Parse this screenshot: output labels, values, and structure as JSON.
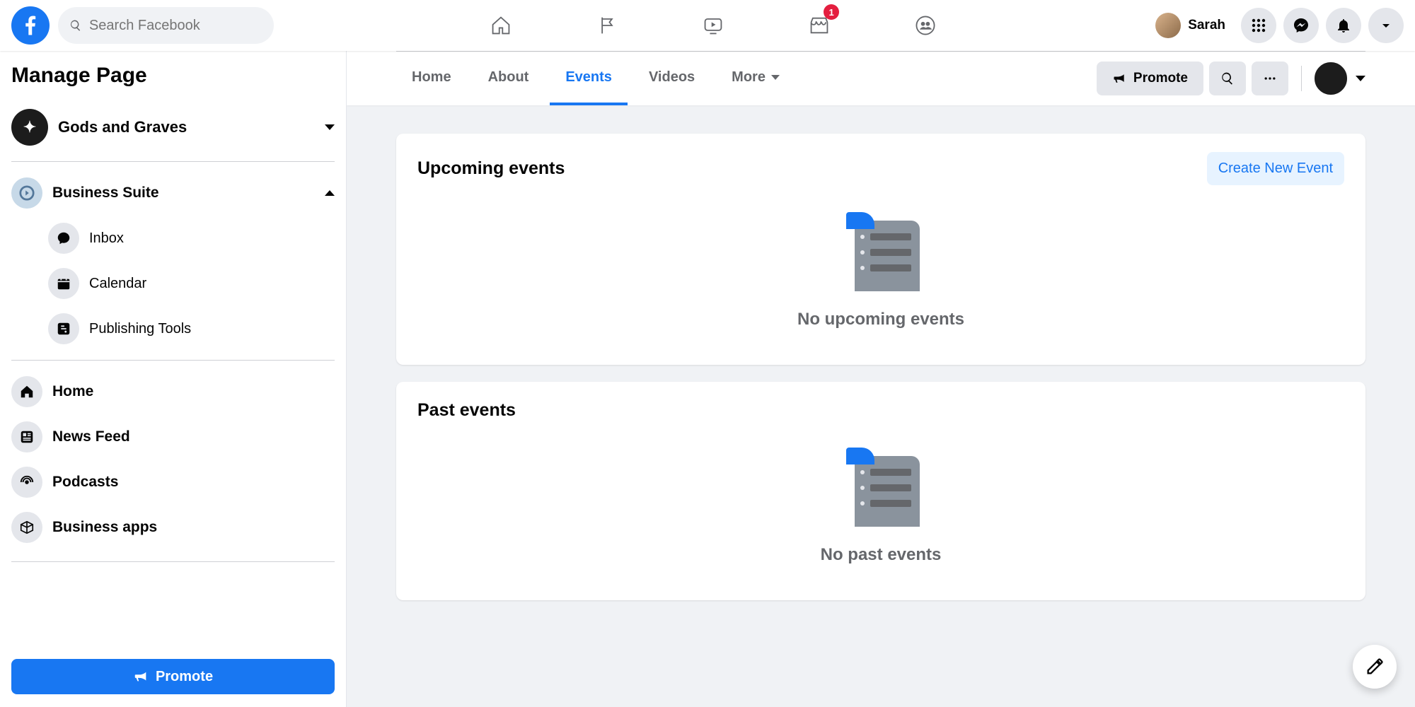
{
  "header": {
    "search_placeholder": "Search Facebook",
    "user_name": "Sarah",
    "marketplace_badge": "1"
  },
  "sidebar": {
    "title": "Manage Page",
    "page_name": "Gods and Graves",
    "business_suite_label": "Business Suite",
    "suite_items": [
      {
        "label": "Inbox"
      },
      {
        "label": "Calendar"
      },
      {
        "label": "Publishing Tools"
      }
    ],
    "nav_items": [
      {
        "label": "Home"
      },
      {
        "label": "News Feed"
      },
      {
        "label": "Podcasts"
      },
      {
        "label": "Business apps"
      }
    ],
    "promote_label": "Promote"
  },
  "page_tabs": {
    "items": [
      "Home",
      "About",
      "Events",
      "Videos",
      "More"
    ],
    "active_index": 2,
    "promote_label": "Promote"
  },
  "upcoming": {
    "heading": "Upcoming events",
    "create_label": "Create New Event",
    "empty_text": "No upcoming events"
  },
  "past": {
    "heading": "Past events",
    "empty_text": "No past events"
  }
}
